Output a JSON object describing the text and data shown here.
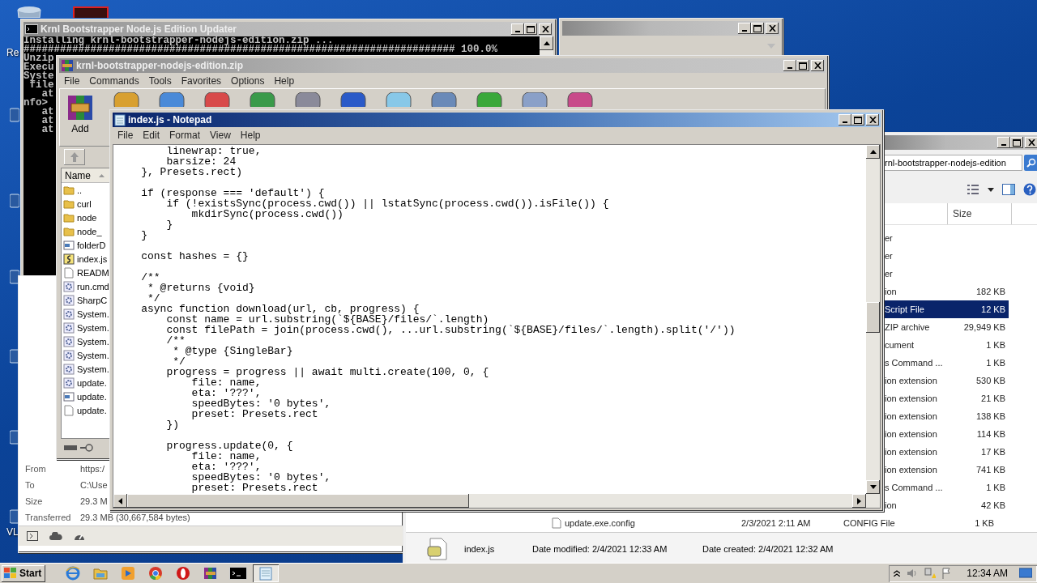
{
  "desktop": {
    "labels": [
      "Re",
      "VL"
    ]
  },
  "console_window": {
    "title": "Krnl Bootstrapper Node.js Edition Updater",
    "lines": [
      "Installing krnl-bootstrapper-nodejs-edition.zip ...",
      "####################################################################### 100.0%",
      "Unzip",
      "Execu",
      "Syste",
      " file",
      "   at",
      "nfo>",
      "   at",
      "   at",
      "   at"
    ]
  },
  "winrar_window": {
    "title": "krnl-bootstrapper-nodejs-edition.zip",
    "menu": [
      "File",
      "Commands",
      "Tools",
      "Favorites",
      "Options",
      "Help"
    ],
    "add_label": "Add",
    "column": "Name",
    "files": [
      {
        "name": "..",
        "kind": "folder"
      },
      {
        "name": "curl",
        "kind": "folder"
      },
      {
        "name": "node",
        "kind": "folder"
      },
      {
        "name": "node_",
        "kind": "folder"
      },
      {
        "name": "folderD",
        "kind": "window"
      },
      {
        "name": "index.js",
        "kind": "script"
      },
      {
        "name": "READM",
        "kind": "text"
      },
      {
        "name": "run.cmd",
        "kind": "gear"
      },
      {
        "name": "SharpC",
        "kind": "gear"
      },
      {
        "name": "System.",
        "kind": "gear"
      },
      {
        "name": "System.",
        "kind": "gear"
      },
      {
        "name": "System.",
        "kind": "gear"
      },
      {
        "name": "System.",
        "kind": "gear"
      },
      {
        "name": "System.",
        "kind": "gear"
      },
      {
        "name": "update.",
        "kind": "gear"
      },
      {
        "name": "update.",
        "kind": "window"
      },
      {
        "name": "update.",
        "kind": "text"
      }
    ]
  },
  "download_dialog": {
    "fields": [
      {
        "label": "From",
        "value": "https:/"
      },
      {
        "label": "To",
        "value": "C:\\Use"
      },
      {
        "label": "Size",
        "value": "29.3 M"
      },
      {
        "label": "Transferred",
        "value": "29.3 MB (30,667,584 bytes)"
      }
    ]
  },
  "explorer_window": {
    "address": "rnl-bootstrapper-nodejs-edition",
    "column": "Size",
    "rows": [
      {
        "type": "er",
        "selected": false
      },
      {
        "type": "er",
        "selected": false
      },
      {
        "type": "er",
        "selected": false
      },
      {
        "type": "ion",
        "size": "182 KB",
        "selected": false
      },
      {
        "type": "Script File",
        "size": "12 KB",
        "selected": true
      },
      {
        "type": "ZIP archive",
        "size": "29,949 KB",
        "selected": false
      },
      {
        "type": "cument",
        "size": "1 KB",
        "selected": false
      },
      {
        "type": "s Command ...",
        "size": "1 KB",
        "selected": false
      },
      {
        "type": "ion extension",
        "size": "530 KB",
        "selected": false
      },
      {
        "type": "ion extension",
        "size": "21 KB",
        "selected": false
      },
      {
        "type": "ion extension",
        "size": "138 KB",
        "selected": false
      },
      {
        "type": "ion extension",
        "size": "114 KB",
        "selected": false
      },
      {
        "type": "ion extension",
        "size": "17 KB",
        "selected": false
      },
      {
        "type": "ion extension",
        "size": "741 KB",
        "selected": false
      },
      {
        "type": "s Command ...",
        "size": "1 KB",
        "selected": false
      },
      {
        "type": "ion",
        "size": "42 KB",
        "selected": false
      }
    ],
    "last_row": {
      "name": "update.exe.config",
      "date": "2/3/2021 2:11 AM",
      "type": "CONFIG File",
      "size": "1 KB"
    },
    "details": {
      "name": "index.js",
      "modified": "Date modified: 2/4/2021 12:33 AM",
      "created": "Date created: 2/4/2021 12:32 AM"
    }
  },
  "notepad_window": {
    "title": "index.js - Notepad",
    "menu": [
      "File",
      "Edit",
      "Format",
      "View",
      "Help"
    ],
    "text": "        linewrap: true,\n        barsize: 24\n    }, Presets.rect)\n\n    if (response === 'default') {\n        if (!existsSync(process.cwd()) || lstatSync(process.cwd()).isFile()) {\n            mkdirSync(process.cwd())\n        }\n    }\n\n    const hashes = {}\n\n    /**\n     * @returns {void}\n     */\n    async function download(url, cb, progress) {\n        const name = url.substring(`${BASE}/files/`.length)\n        const filePath = join(process.cwd(), ...url.substring(`${BASE}/files/`.length).split('/'))\n        /**\n         * @type {SingleBar}\n         */\n        progress = progress || await multi.create(100, 0, {\n            file: name,\n            eta: '???',\n            speedBytes: '0 bytes',\n            preset: Presets.rect\n        })\n\n        progress.update(0, {\n            file: name,\n            eta: '???',\n            speedBytes: '0 bytes',\n            preset: Presets.rect"
  },
  "taskbar": {
    "start": "Start",
    "apps": [
      {
        "kind": "browser",
        "selected": false
      },
      {
        "kind": "folder",
        "selected": false
      },
      {
        "kind": "media",
        "selected": false
      },
      {
        "kind": "chrome",
        "selected": false
      },
      {
        "kind": "opera",
        "selected": false
      },
      {
        "kind": "archive",
        "selected": false
      },
      {
        "kind": "console",
        "selected": false
      },
      {
        "kind": "notepad",
        "selected": true
      }
    ],
    "clock": "12:34 AM"
  }
}
